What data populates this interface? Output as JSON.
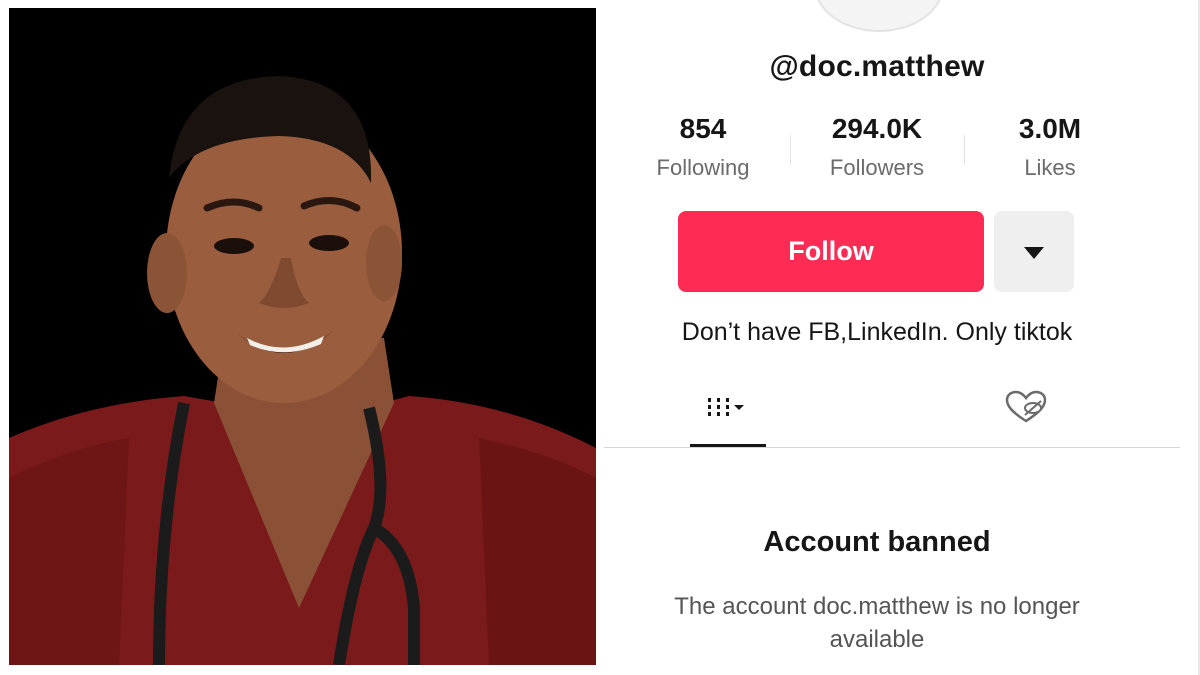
{
  "profile": {
    "username": "@doc.matthew",
    "stats": [
      {
        "value": "854",
        "label": "Following"
      },
      {
        "value": "294.0K",
        "label": "Followers"
      },
      {
        "value": "3.0M",
        "label": "Likes"
      }
    ],
    "follow_label": "Follow",
    "more_icon": "caret-down-icon",
    "bio": "Don’t have FB,LinkedIn. Only tiktok",
    "tabs": [
      {
        "icon": "videos-grid-icon",
        "active": true
      },
      {
        "icon": "liked-hidden-icon",
        "active": false
      }
    ],
    "banned_title": "Account banned",
    "banned_desc_line1": "The account doc.matthew is no longer",
    "banned_desc_line2": "available"
  },
  "colors": {
    "follow": "#fe2c55",
    "scrubs": "#7a1a1a",
    "photo_bg": "#000000"
  }
}
